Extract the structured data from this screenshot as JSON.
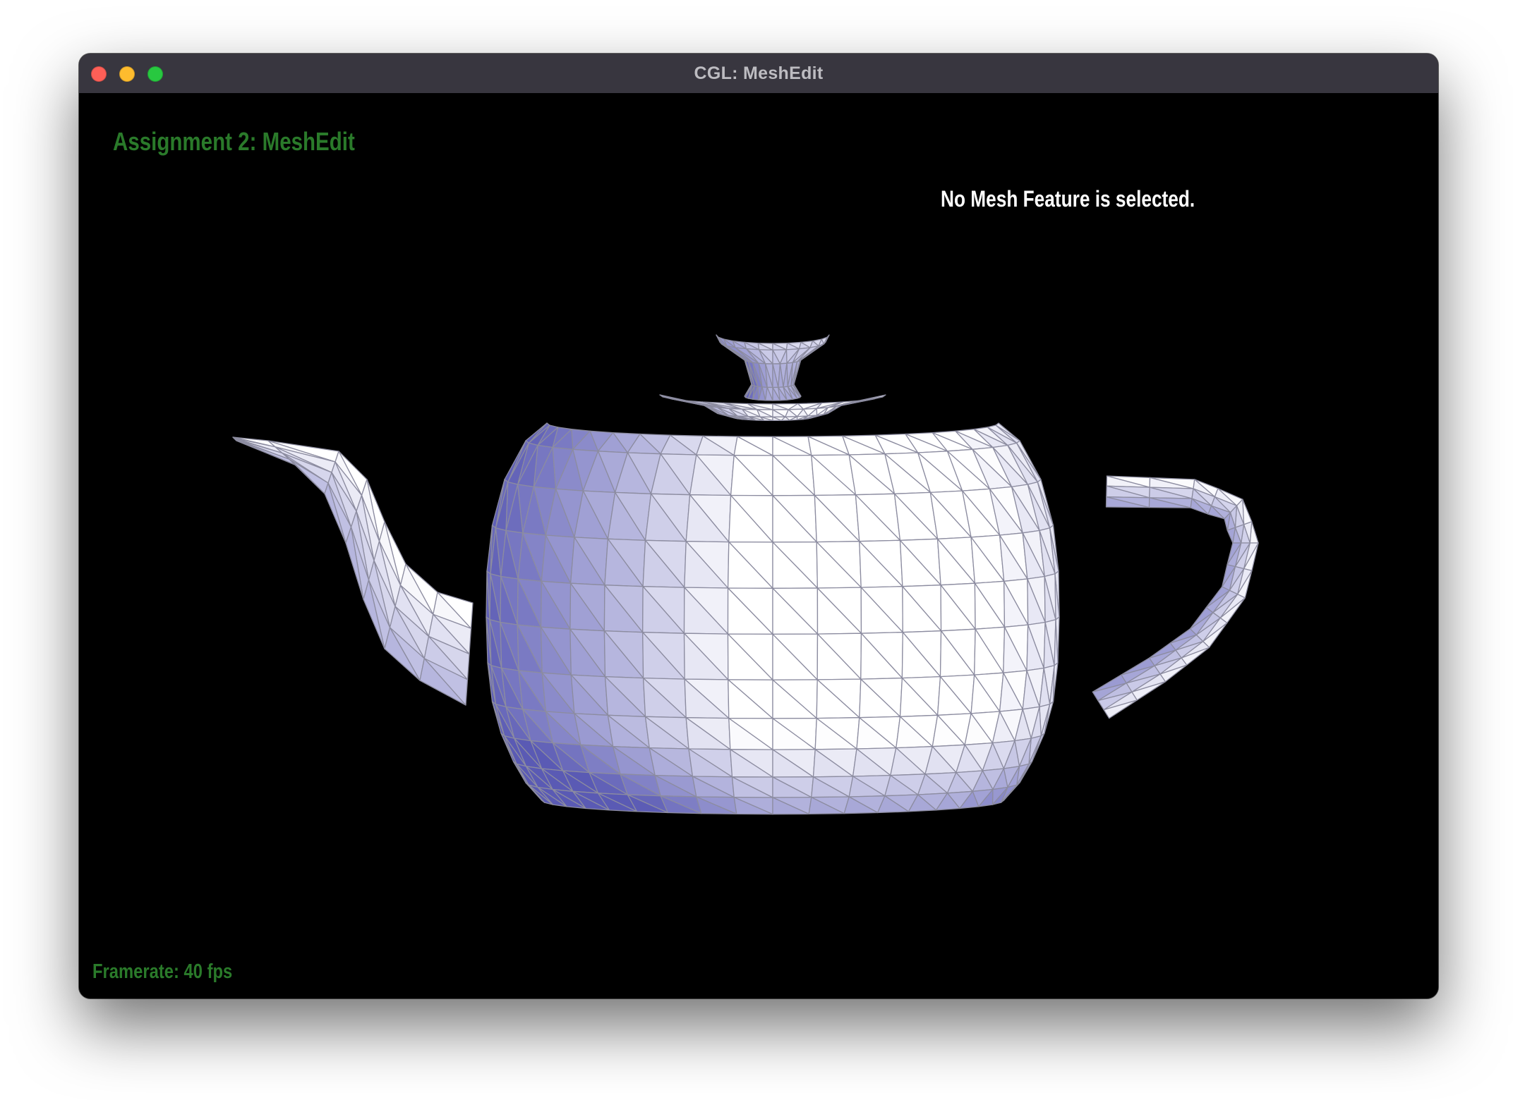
{
  "window": {
    "title": "CGL: MeshEdit"
  },
  "hud": {
    "assignment_title": "Assignment 2: MeshEdit",
    "selection_status": "No Mesh Feature is selected.",
    "framerate": "Framerate: 40 fps"
  },
  "colors": {
    "hud_green": "#2a7a2a",
    "mesh_light": "#ffffff",
    "mesh_dark": "#5a5ab4",
    "wire": "#8c8ca0",
    "close": "#fe5f57",
    "minimize": "#febc2e",
    "maximize": "#28c840"
  },
  "viewport": {
    "mesh": "teapot"
  }
}
